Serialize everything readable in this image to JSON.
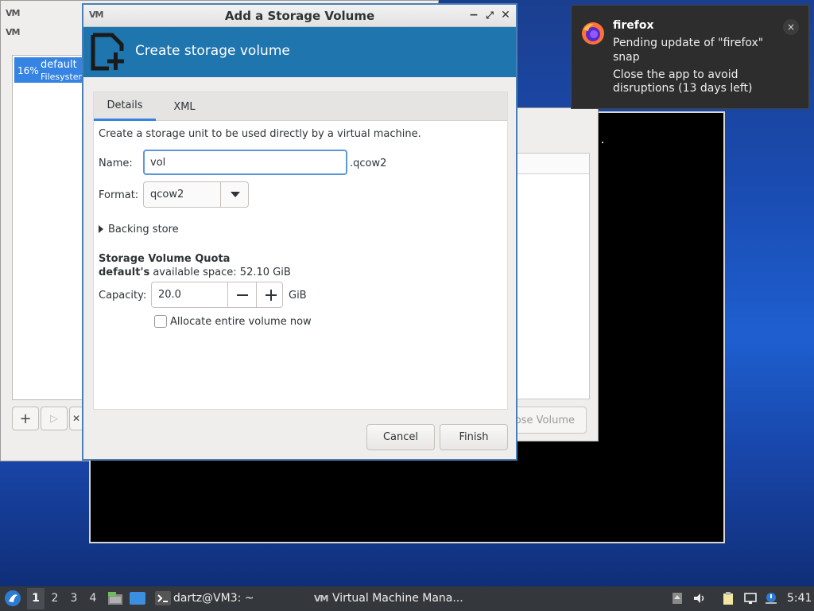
{
  "background_window": {
    "pool": {
      "percent": "16%",
      "name": "default",
      "type": "Filesystem"
    },
    "add_label": "+",
    "play_label": "▷",
    "close_label": "✕"
  },
  "right_panel": {
    "close_volume_label": "ose Volume"
  },
  "dialog": {
    "app_icon": "VM",
    "title": "Add a Storage Volume",
    "minimize": "−",
    "maximize": "⤢",
    "close": "✕",
    "banner": "Create storage volume",
    "tabs": [
      "Details",
      "XML"
    ],
    "description": "Create a storage unit to be used directly by a virtual machine.",
    "name_label": "Name:",
    "name_value": "vol",
    "name_suffix": ".qcow2",
    "format_label": "Format:",
    "format_value": "qcow2",
    "backing_store": "Backing store",
    "quota_heading": "Storage Volume Quota",
    "quota_pool": "default's",
    "quota_text": "available space: 52.10 GiB",
    "capacity_label": "Capacity:",
    "capacity_value": "20.0",
    "capacity_unit": "GiB",
    "allocate_label": "Allocate entire volume now",
    "allocate_checked": false,
    "cancel": "Cancel",
    "finish": "Finish"
  },
  "notification": {
    "app": "firefox",
    "line1": "Pending update of \"firefox\"",
    "line2": "snap",
    "line3": "Close the app to avoid",
    "line4": "disruptions (13 days left)",
    "close": "×"
  },
  "taskbar": {
    "workspaces": [
      "1",
      "2",
      "3",
      "4"
    ],
    "active_workspace": "1",
    "terminal_label": "dartz@VM3: ~",
    "vmm_label": "Virtual Machine Mana...",
    "vmm_icon": "VM",
    "clock": "5:41"
  },
  "colors": {
    "accent": "#3584e4",
    "banner": "#1f75ad",
    "taskbar": "#34373b"
  }
}
